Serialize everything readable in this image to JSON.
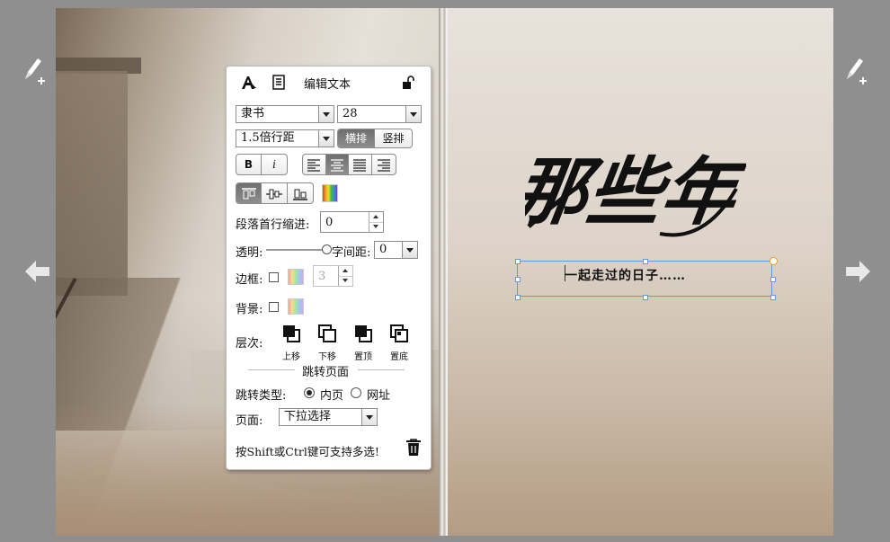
{
  "book": {
    "cover_title": "那些年",
    "selected_text": "一起走过的日子……"
  },
  "panel": {
    "header_title": "编辑文本",
    "font_family": "隶书",
    "font_size": "28",
    "line_spacing": "1.5倍行距",
    "orientation_horizontal": "横排",
    "orientation_vertical": "竖排",
    "bold_label": "B",
    "italic_label": "i",
    "indent_label": "段落首行缩进:",
    "indent_value": "0",
    "opacity_label": "透明:",
    "opacity_level": 1.0,
    "letter_spacing_label": "字间距:",
    "letter_spacing_value": "0",
    "border_label": "边框:",
    "border_width": "3",
    "background_label": "背景:",
    "layer_label": "层次:",
    "layer_up": "上移",
    "layer_down": "下移",
    "layer_top": "置顶",
    "layer_bottom": "置底",
    "jump_section_title": "跳转页面",
    "jump_type_label": "跳转类型:",
    "jump_inner": "内页",
    "jump_url": "网址",
    "page_label": "页面:",
    "page_select": "下拉选择",
    "hint": "按Shift或Ctrl键可支持多选!"
  },
  "colors": {
    "selection_border": "#6c94d8",
    "rotate_handle": "#f0a020",
    "background": "#8f8f8f"
  }
}
